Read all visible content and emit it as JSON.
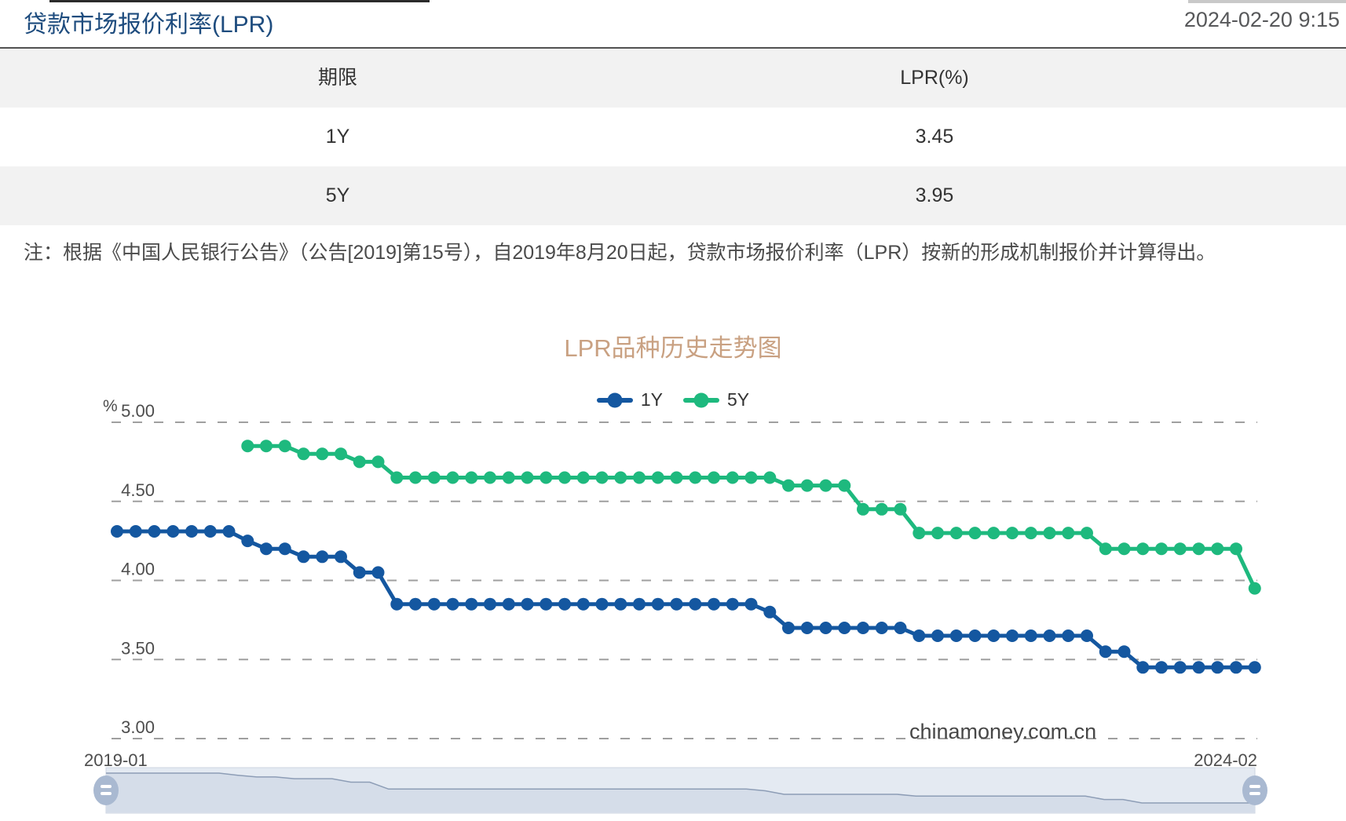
{
  "header": {
    "title": "贷款市场报价利率(LPR)",
    "timestamp": "2024-02-20 9:15"
  },
  "table": {
    "columns": [
      "期限",
      "LPR(%)"
    ],
    "rows": [
      [
        "1Y",
        "3.45"
      ],
      [
        "5Y",
        "3.95"
      ]
    ]
  },
  "note": "注：根据《中国人民银行公告》（公告[2019]第15号），自2019年8月20日起，贷款市场报价利率（LPR）按新的形成机制报价并计算得出。",
  "chart_data": {
    "type": "line",
    "title": "LPR品种历史走势图",
    "ylabel": "%",
    "ylim": [
      3.0,
      5.0
    ],
    "yticks": [
      5.0,
      4.5,
      4.0,
      3.5,
      3.0
    ],
    "ytick_labels": [
      "5.00",
      "4.50",
      "4.00",
      "3.50",
      "3.00"
    ],
    "grid": "dashed-horizontal",
    "legend_position": "top-center",
    "x_axis_labels": [
      "2019-01",
      "2024-02"
    ],
    "x": [
      "2019-01",
      "2019-02",
      "2019-03",
      "2019-04",
      "2019-05",
      "2019-06",
      "2019-07",
      "2019-08",
      "2019-09",
      "2019-10",
      "2019-11",
      "2019-12",
      "2020-01",
      "2020-02",
      "2020-03",
      "2020-04",
      "2020-05",
      "2020-06",
      "2020-07",
      "2020-08",
      "2020-09",
      "2020-10",
      "2020-11",
      "2020-12",
      "2021-01",
      "2021-02",
      "2021-03",
      "2021-04",
      "2021-05",
      "2021-06",
      "2021-07",
      "2021-08",
      "2021-09",
      "2021-10",
      "2021-11",
      "2021-12",
      "2022-01",
      "2022-02",
      "2022-03",
      "2022-04",
      "2022-05",
      "2022-06",
      "2022-07",
      "2022-08",
      "2022-09",
      "2022-10",
      "2022-11",
      "2022-12",
      "2023-01",
      "2023-02",
      "2023-03",
      "2023-04",
      "2023-05",
      "2023-06",
      "2023-07",
      "2023-08",
      "2023-09",
      "2023-10",
      "2023-11",
      "2023-12",
      "2024-01",
      "2024-02"
    ],
    "series": [
      {
        "name": "1Y",
        "color": "#1457a0",
        "values": [
          4.31,
          4.31,
          4.31,
          4.31,
          4.31,
          4.31,
          4.31,
          4.25,
          4.2,
          4.2,
          4.15,
          4.15,
          4.15,
          4.05,
          4.05,
          3.85,
          3.85,
          3.85,
          3.85,
          3.85,
          3.85,
          3.85,
          3.85,
          3.85,
          3.85,
          3.85,
          3.85,
          3.85,
          3.85,
          3.85,
          3.85,
          3.85,
          3.85,
          3.85,
          3.85,
          3.8,
          3.7,
          3.7,
          3.7,
          3.7,
          3.7,
          3.7,
          3.7,
          3.65,
          3.65,
          3.65,
          3.65,
          3.65,
          3.65,
          3.65,
          3.65,
          3.65,
          3.65,
          3.55,
          3.55,
          3.45,
          3.45,
          3.45,
          3.45,
          3.45,
          3.45,
          3.45
        ]
      },
      {
        "name": "5Y",
        "color": "#1eb97e",
        "values": [
          null,
          null,
          null,
          null,
          null,
          null,
          null,
          4.85,
          4.85,
          4.85,
          4.8,
          4.8,
          4.8,
          4.75,
          4.75,
          4.65,
          4.65,
          4.65,
          4.65,
          4.65,
          4.65,
          4.65,
          4.65,
          4.65,
          4.65,
          4.65,
          4.65,
          4.65,
          4.65,
          4.65,
          4.65,
          4.65,
          4.65,
          4.65,
          4.65,
          4.65,
          4.6,
          4.6,
          4.6,
          4.6,
          4.45,
          4.45,
          4.45,
          4.3,
          4.3,
          4.3,
          4.3,
          4.3,
          4.3,
          4.3,
          4.3,
          4.3,
          4.3,
          4.2,
          4.2,
          4.2,
          4.2,
          4.2,
          4.2,
          4.2,
          4.2,
          3.95
        ]
      }
    ],
    "watermark": "chinamoney.com.cn"
  }
}
